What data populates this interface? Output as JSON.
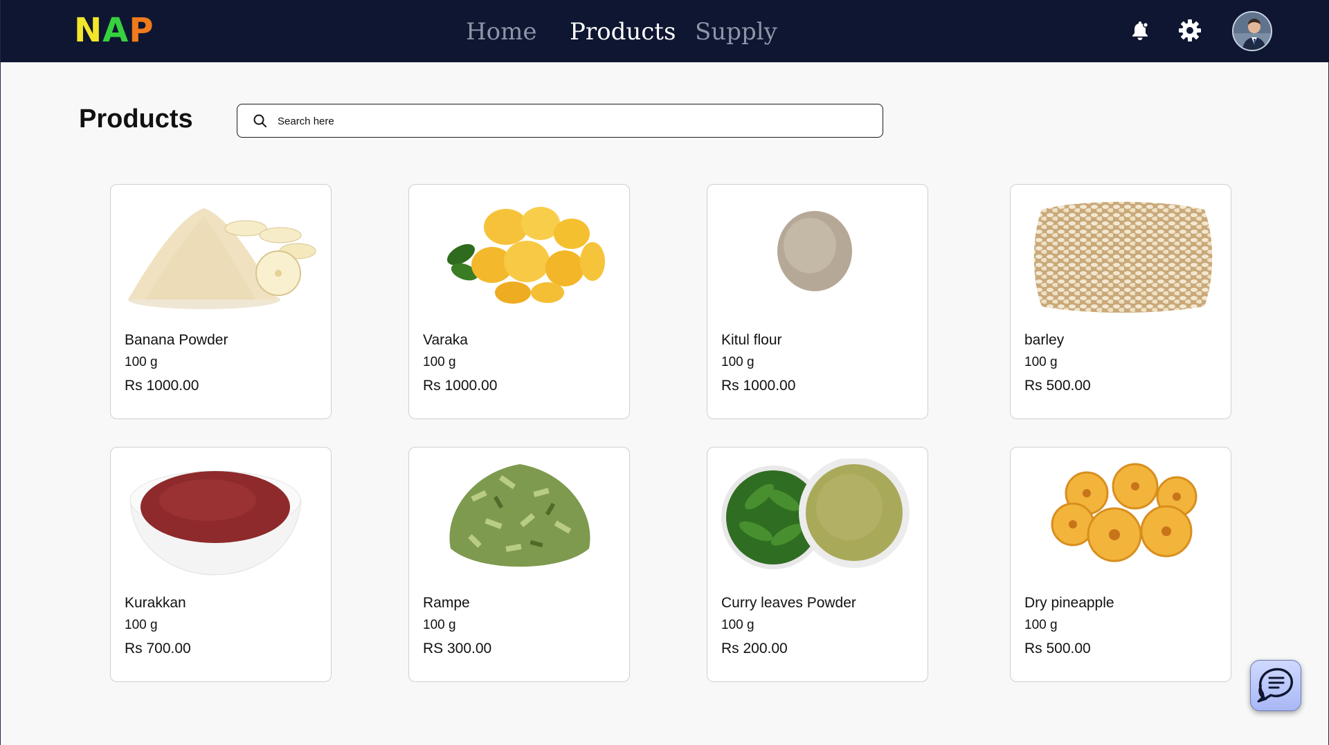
{
  "brand": {
    "logo_part1": "N",
    "logo_part2": "A",
    "logo_part3": "P"
  },
  "nav": {
    "items": [
      {
        "label": "Home",
        "active": false
      },
      {
        "label": "Products",
        "active": true
      },
      {
        "label": "Supply",
        "active": false
      }
    ],
    "icons": [
      "bell-icon",
      "gear-icon",
      "avatar"
    ]
  },
  "page": {
    "title": "Products"
  },
  "search": {
    "placeholder": "Search here",
    "value": ""
  },
  "products": [
    {
      "name": "Banana Powder",
      "qty": "100 g",
      "price": "Rs 1000.00",
      "image": "banana-powder-image"
    },
    {
      "name": "Varaka",
      "qty": "100 g",
      "price": "Rs 1000.00",
      "image": "varaka-image"
    },
    {
      "name": "Kitul flour",
      "qty": "100 g",
      "price": "Rs 1000.00",
      "image": "kitul-flour-image"
    },
    {
      "name": "barley",
      "qty": "100 g",
      "price": "Rs 500.00",
      "image": "barley-image"
    },
    {
      "name": "Kurakkan",
      "qty": "100 g",
      "price": "Rs 700.00",
      "image": "kurakkan-image"
    },
    {
      "name": "Rampe",
      "qty": "100 g",
      "price": "RS 300.00",
      "image": "rampe-image"
    },
    {
      "name": "Curry leaves Powder",
      "qty": "100 g",
      "price": "Rs 200.00",
      "image": "curry-leaves-powder-image"
    },
    {
      "name": "Dry pineapple",
      "qty": "100 g",
      "price": "Rs 500.00",
      "image": "dry-pineapple-image"
    }
  ],
  "colors": {
    "nav_bg": "#0f1631",
    "page_bg": "#f8f8f8",
    "card_border": "#cfcfcf",
    "logo_yellow": "#f2e62a",
    "logo_green": "#36d13f",
    "logo_orange": "#f07a1c"
  }
}
